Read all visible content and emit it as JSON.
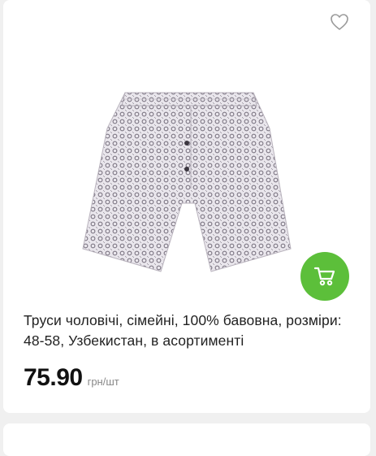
{
  "product": {
    "title": "Труси чоловічі, сімейні, 100% бавовна, розміри: 48-58, Узбекистан, в асортименті",
    "price": "75.90",
    "unit": "грн/шт",
    "image_alt": "men-boxer-shorts-patterned",
    "favorite_icon": "heart-outline-icon",
    "cart_icon": "cart-icon"
  },
  "colors": {
    "accent_green": "#5cbf3a",
    "background": "#f0f0f0",
    "card": "#ffffff"
  }
}
